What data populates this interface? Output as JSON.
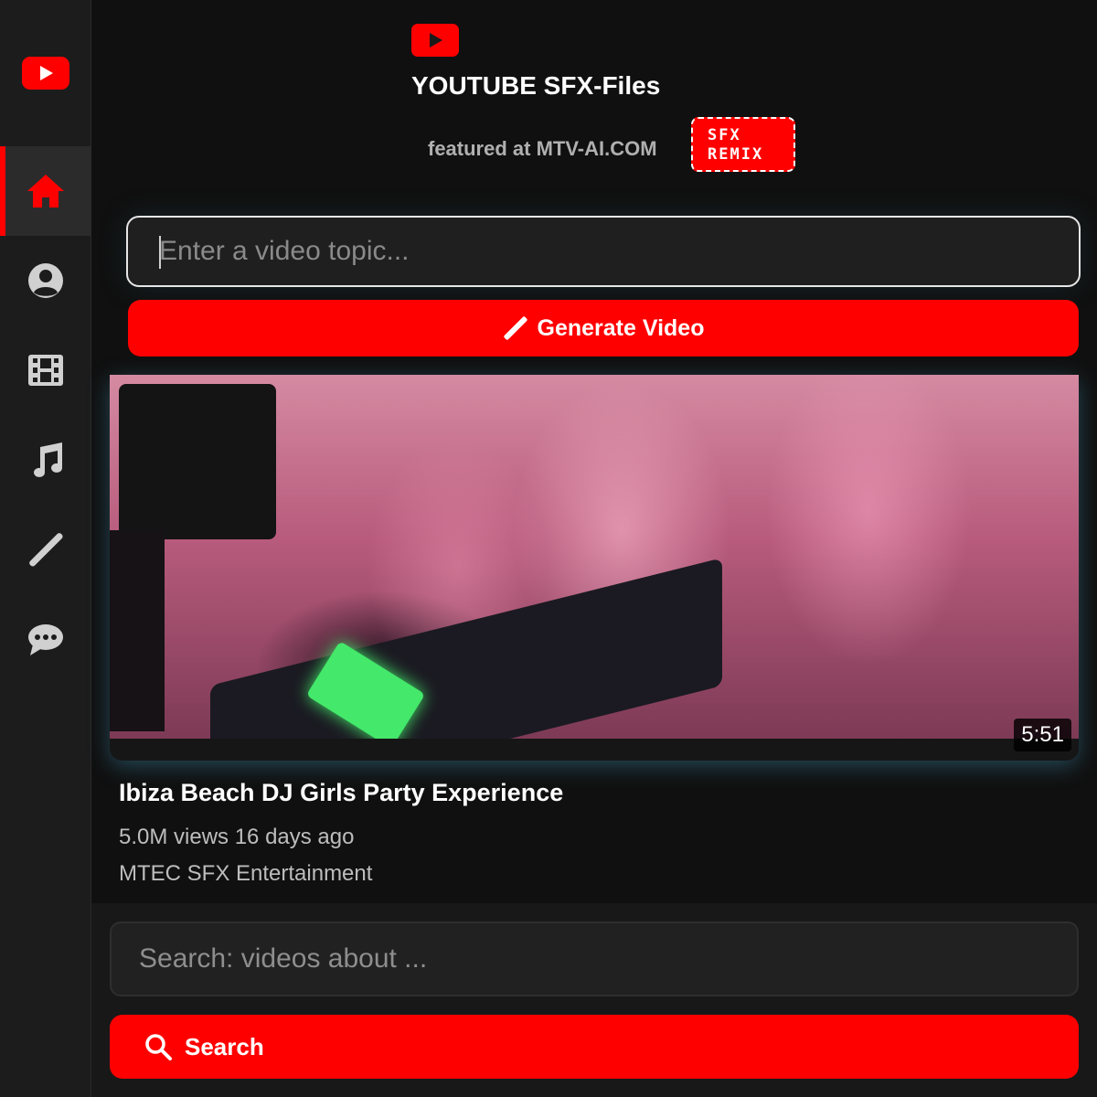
{
  "sidebar": {
    "logo_icon": "youtube-logo-icon",
    "items": [
      {
        "icon": "home-icon",
        "active": true
      },
      {
        "icon": "user-icon",
        "active": false
      },
      {
        "icon": "film-icon",
        "active": false
      },
      {
        "icon": "music-icon",
        "active": false
      },
      {
        "icon": "magic-wand-icon",
        "active": false
      },
      {
        "icon": "chat-icon",
        "active": false
      }
    ]
  },
  "header": {
    "logo_icon": "youtube-logo-icon",
    "title": "YOUTUBE SFX-Files",
    "featured": "featured at MTV-AI.COM",
    "badge_line1": "SFX",
    "badge_line2": "REMIX"
  },
  "generator": {
    "placeholder": "Enter a video topic...",
    "value": "",
    "button_label": "Generate Video",
    "button_icon": "magic-wand-icon"
  },
  "video": {
    "duration": "5:51",
    "title": "Ibiza Beach DJ Girls Party Experience",
    "meta": "5.0M views 16 days ago",
    "channel": "MTEC SFX Entertainment"
  },
  "search": {
    "placeholder": "Search: videos about ...",
    "value": "",
    "button_label": "Search",
    "button_icon": "search-icon"
  },
  "colors": {
    "accent": "#ff0000",
    "background": "#0f0f0f",
    "sidebar": "#1c1c1c",
    "icon": "#d0d0d0"
  }
}
